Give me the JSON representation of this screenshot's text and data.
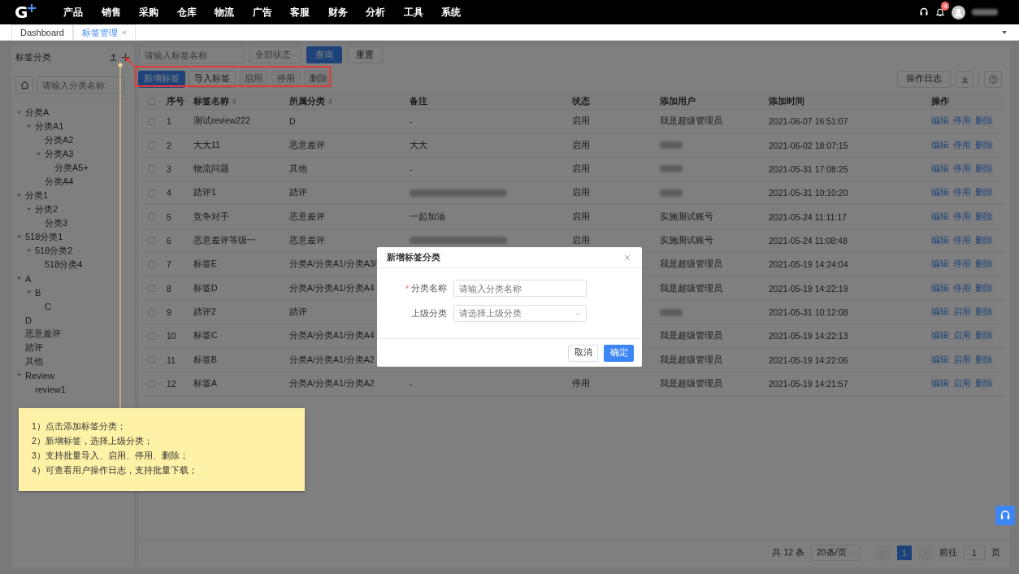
{
  "topnav": {
    "logo": "G",
    "menu": [
      "产品",
      "销售",
      "采购",
      "仓库",
      "物流",
      "广告",
      "客服",
      "财务",
      "分析",
      "工具",
      "系统"
    ],
    "notification_count": "4",
    "user_blurred": true
  },
  "tabs": [
    {
      "label": "Dashboard",
      "selected": false,
      "closable": false
    },
    {
      "label": "标签管理",
      "selected": true,
      "closable": true
    }
  ],
  "sidebar": {
    "title": "标签分类",
    "search": {
      "placeholder": "请输入分类名称"
    },
    "tree": [
      {
        "label": "分类A",
        "expanded": true,
        "children": [
          {
            "label": "分类A1",
            "expanded": true,
            "children": [
              {
                "label": "分类A2"
              },
              {
                "label": "分类A3",
                "expanded": true,
                "children": [
                  {
                    "label": "分类A5+"
                  }
                ]
              },
              {
                "label": "分类A4"
              }
            ]
          }
        ]
      },
      {
        "label": "分类1",
        "expanded": true,
        "children": [
          {
            "label": "分类2",
            "expanded": true,
            "children": [
              {
                "label": "分类3"
              }
            ]
          }
        ]
      },
      {
        "label": "518分类1",
        "expanded": true,
        "children": [
          {
            "label": "518分类2",
            "expanded": true,
            "children": [
              {
                "label": "518分类4"
              }
            ]
          }
        ]
      },
      {
        "label": "A",
        "expanded": true,
        "children": [
          {
            "label": "B",
            "expanded": true,
            "children": [
              {
                "label": "C"
              }
            ]
          }
        ]
      },
      {
        "label": "D"
      },
      {
        "label": "恶意差评"
      },
      {
        "label": "踏评"
      },
      {
        "label": "其他"
      },
      {
        "label": "Review",
        "expanded": true,
        "children": [
          {
            "label": "review1"
          }
        ]
      }
    ]
  },
  "filters": {
    "name": {
      "placeholder": "请输入标签名称"
    },
    "status": {
      "placeholder": "全部状态"
    },
    "buttons": [
      {
        "label": "查询",
        "kind": "primary"
      },
      {
        "label": "重置",
        "kind": "default"
      }
    ]
  },
  "actions": [
    {
      "label": "新增标签",
      "kind": "primary",
      "disabled": false
    },
    {
      "label": "导入标签",
      "kind": "default",
      "disabled": false
    },
    {
      "label": "启用",
      "kind": "default",
      "disabled": true
    },
    {
      "label": "停用",
      "kind": "default",
      "disabled": true
    },
    {
      "label": "删除",
      "kind": "default",
      "disabled": true
    }
  ],
  "toolbar_right": {
    "log_button": "操作日志"
  },
  "table": {
    "all_checked": false,
    "columns": [
      "序号",
      "标签名称",
      "所属分类",
      "备注",
      "状态",
      "添加用户",
      "添加时间",
      "操作"
    ],
    "sortable": [
      false,
      true,
      true,
      false,
      false,
      false,
      false,
      false
    ],
    "rows": [
      {
        "checked": false,
        "seq": "1",
        "name": "测试review222",
        "category": "D",
        "note": "-",
        "status": "启用",
        "user": "我是超级管理员",
        "time": "2021-06-07 16:51:07",
        "ops": [
          "编辑",
          "停用",
          "删除"
        ]
      },
      {
        "checked": false,
        "seq": "2",
        "name": "大大11",
        "category": "恶意差评",
        "note": "大大",
        "status": "启用",
        "user_blurred": true,
        "time": "2021-06-02 18:07:15",
        "ops": [
          "编辑",
          "停用",
          "删除"
        ]
      },
      {
        "checked": false,
        "seq": "3",
        "name": "物流问题",
        "category": "其他",
        "note": "-",
        "status": "启用",
        "user_blurred": true,
        "time": "2021-05-31 17:08:25",
        "ops": [
          "编辑",
          "停用",
          "删除"
        ]
      },
      {
        "checked": false,
        "seq": "4",
        "name": "踏评1",
        "category": "踏评",
        "note_blurred": true,
        "status": "启用",
        "user_blurred": true,
        "time": "2021-05-31 10:10:20",
        "ops": [
          "编辑",
          "停用",
          "删除"
        ]
      },
      {
        "checked": false,
        "seq": "5",
        "name": "竞争对手",
        "category": "恶意差评",
        "note": "一起加油",
        "status": "启用",
        "user": "实施测试账号",
        "time": "2021-05-24 11:11:17",
        "ops": [
          "编辑",
          "停用",
          "删除"
        ]
      },
      {
        "checked": false,
        "seq": "6",
        "name": "恶意差评等级一",
        "category": "恶意差评",
        "note_blurred": true,
        "status": "启用",
        "user": "实施测试账号",
        "time": "2021-05-24 11:08:48",
        "ops": [
          "编辑",
          "停用",
          "删除"
        ]
      },
      {
        "checked": false,
        "seq": "7",
        "name": "标签E",
        "category": "分类A/分类A1/分类A3/",
        "user": "我是超级管理员",
        "time": "2021-05-19 14:24:04",
        "ops": [
          "编辑",
          "停用",
          "删除"
        ]
      },
      {
        "checked": false,
        "seq": "8",
        "name": "标签D",
        "category": "分类A/分类A1/分类A4",
        "user": "我是超级管理员",
        "time": "2021-05-19 14:22:19",
        "ops": [
          "编辑",
          "停用",
          "删除"
        ]
      },
      {
        "checked": false,
        "seq": "9",
        "name": "踏评2",
        "category": "踏评",
        "user_blurred": true,
        "time": "2021-05-31 10:12:08",
        "ops": [
          "编辑",
          "启用",
          "删除"
        ]
      },
      {
        "checked": false,
        "seq": "10",
        "name": "标签C",
        "category": "分类A/分类A1/分类A4",
        "user": "我是超级管理员",
        "time": "2021-05-19 14:22:13",
        "ops": [
          "编辑",
          "启用",
          "删除"
        ]
      },
      {
        "checked": false,
        "seq": "11",
        "name": "标签B",
        "category": "分类A/分类A1/分类A2",
        "user": "我是超级管理员",
        "time": "2021-05-19 14:22:06",
        "ops": [
          "编辑",
          "启用",
          "删除"
        ]
      },
      {
        "checked": false,
        "seq": "12",
        "name": "标签A",
        "category": "分类A/分类A1/分类A2",
        "note": "-",
        "status": "停用",
        "user": "我是超级管理员",
        "time": "2021-05-19 14:21:57",
        "ops": [
          "编辑",
          "启用",
          "删除"
        ]
      }
    ]
  },
  "pagination": {
    "total": "共 12 条",
    "page_size": "20条/页",
    "pages": [
      {
        "label": "1",
        "selected": true
      }
    ],
    "goto_label": "前往",
    "goto_value": "1",
    "goto_suffix": "页"
  },
  "modal": {
    "title": "新增标签分类",
    "fields": [
      {
        "label": "分类名称",
        "required": true,
        "marker": "*",
        "kind": "input",
        "placeholder": "请输入分类名称"
      },
      {
        "label": "上级分类",
        "kind": "select",
        "placeholder": "请选择上级分类"
      }
    ],
    "buttons": [
      {
        "label": "取消",
        "kind": "default"
      },
      {
        "label": "确定",
        "kind": "primary"
      }
    ]
  },
  "annotation": {
    "notes": [
      "1）点击添加标签分类；",
      "2）新增标签，选择上级分类；",
      "3）支持批量导入、启用、停用、删除；",
      "4）可查看用户操作日志，支持批量下载；"
    ]
  }
}
